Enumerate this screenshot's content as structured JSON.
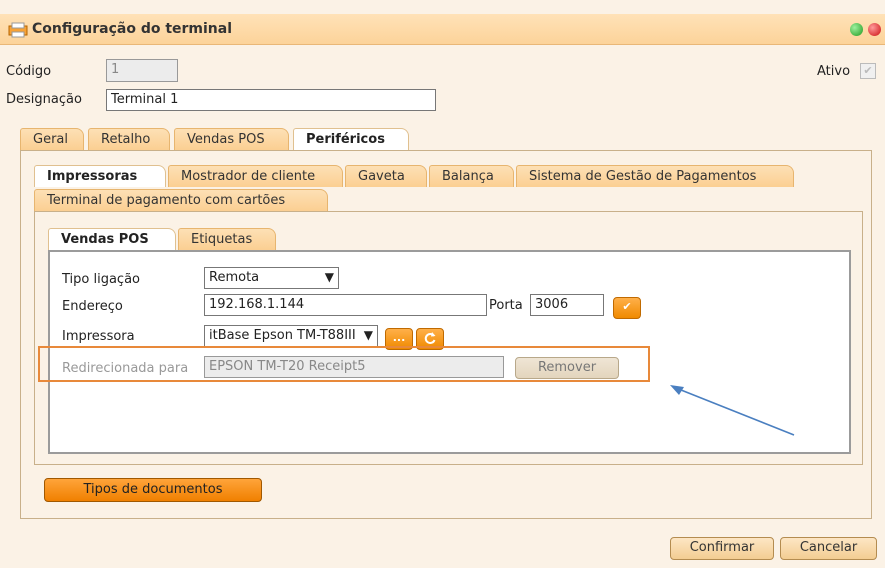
{
  "window": {
    "title": "Configuração do terminal"
  },
  "form": {
    "codigo_label": "Código",
    "codigo_value": "1",
    "ativo_label": "Ativo",
    "designacao_label": "Designação",
    "designacao_value": "Terminal 1"
  },
  "main_tabs": [
    "Geral",
    "Retalho",
    "Vendas POS",
    "Periféricos"
  ],
  "periph_tabs": [
    "Impressoras",
    "Mostrador de cliente",
    "Gaveta",
    "Balança",
    "Sistema de Gestão de Pagamentos",
    "Terminal de pagamento com cartões"
  ],
  "printer_tabs": [
    "Vendas POS",
    "Etiquetas"
  ],
  "printer": {
    "tipo_label": "Tipo ligação",
    "tipo_value": "Remota",
    "endereco_label": "Endereço",
    "endereco_value": "192.168.1.144",
    "porta_label": "Porta",
    "porta_value": "3006",
    "impressora_label": "Impressora",
    "impressora_value": "itBase Epson TM-T88III",
    "redirect_label": "Redirecionada para",
    "redirect_value": "EPSON TM-T20 Receipt5",
    "remover_label": "Remover"
  },
  "buttons": {
    "tipos_documentos": "Tipos de documentos",
    "confirmar": "Confirmar",
    "cancelar": "Cancelar",
    "ellipsis_icon_text": "..."
  },
  "icons": [
    "printer-config-icon",
    "check-icon",
    "ellipsis-icon",
    "refresh-icon",
    "dropdown-arrow-icon"
  ],
  "colors": {
    "accent_orange": "#f08000",
    "highlight_box": "#e8893a",
    "annotation_arrow": "#4a7fc0",
    "tab_bg": "#fbcf92"
  }
}
